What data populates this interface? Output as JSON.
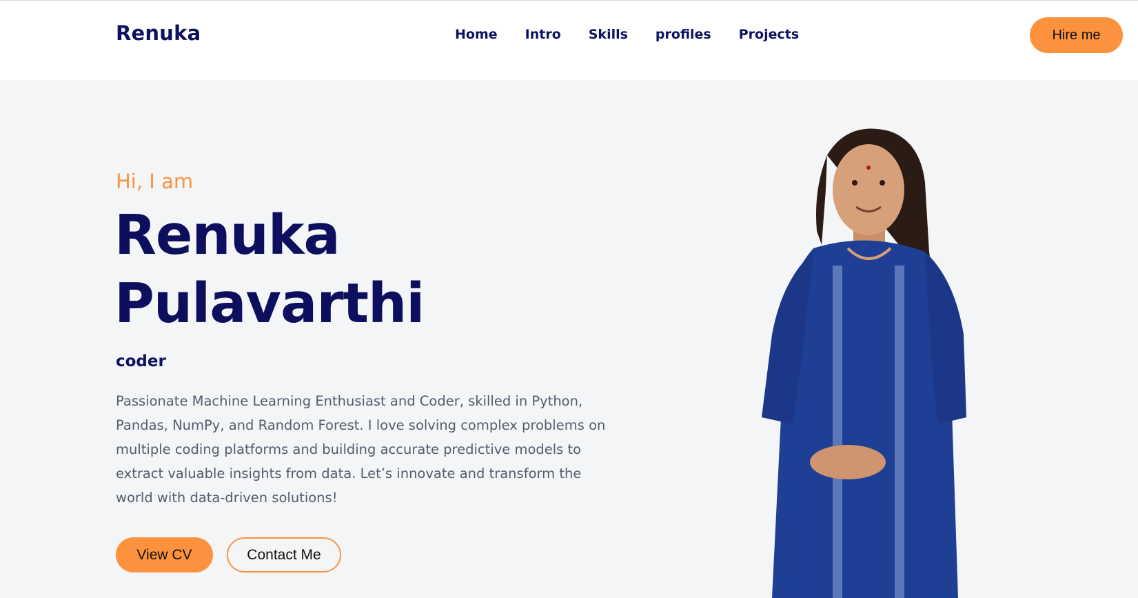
{
  "header": {
    "brand": "Renuka",
    "nav": [
      "Home",
      "Intro",
      "Skills",
      "profiles",
      "Projects"
    ],
    "hire_label": "Hire me"
  },
  "hero": {
    "greeting": "Hi, I am",
    "name_line1": "Renuka",
    "name_line2": "Pulavarthi",
    "role": "coder",
    "bio": "Passionate Machine Learning Enthusiast and Coder, skilled in Python, Pandas, NumPy, and Random Forest. I love solving complex problems on multiple coding platforms and building accurate predictive models to extract valuable insights from data. Let’s innovate and transform the world with data-driven solutions!",
    "cv_label": "View CV",
    "contact_label": "Contact Me"
  },
  "colors": {
    "accent": "#fd923e",
    "navy": "#0d1260",
    "background": "#f4f5f7",
    "dress": "#1f3f95"
  },
  "icons": {
    "portrait": "profile-photo"
  }
}
